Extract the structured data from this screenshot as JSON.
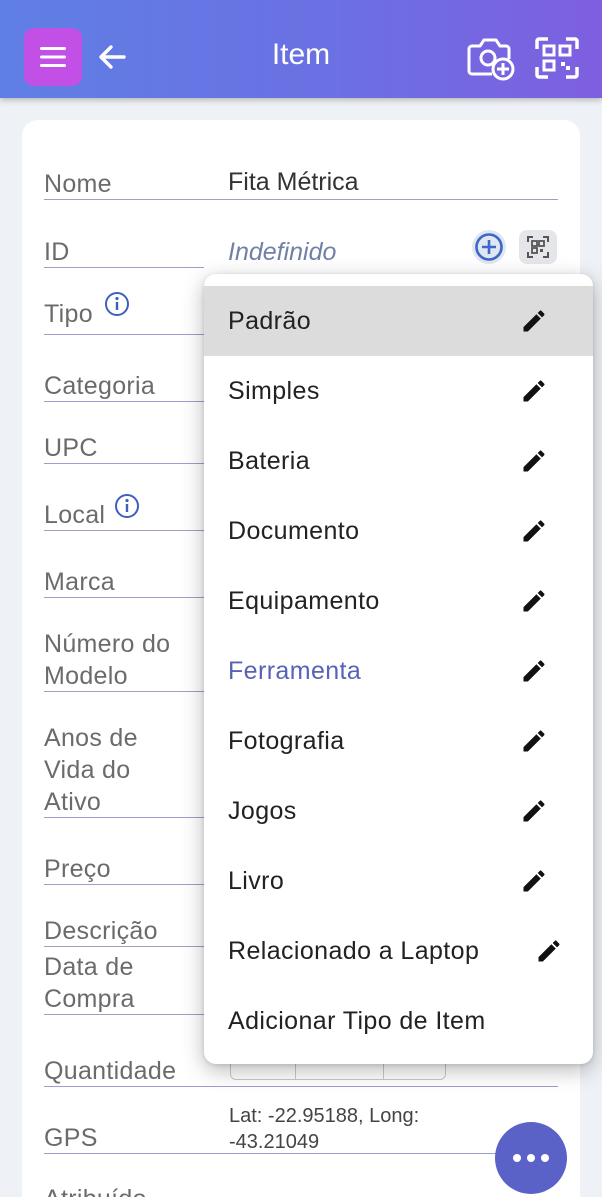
{
  "header": {
    "title": "Item",
    "menu_icon": "menu-icon",
    "back_icon": "arrow-left-icon",
    "camera_icon": "camera-add-icon",
    "scan_icon": "qr-scan-icon",
    "gradient": [
      "#5f7fe6",
      "#7e5fe0"
    ],
    "menu_color": "#c24fe6"
  },
  "form": {
    "name": {
      "label": "Nome",
      "value": "Fita Métrica"
    },
    "id": {
      "label": "ID",
      "placeholder": "Indefinido"
    },
    "type": {
      "label": "Tipo"
    },
    "category": {
      "label": "Categoria"
    },
    "upc": {
      "label": "UPC"
    },
    "location": {
      "label": "Local"
    },
    "brand": {
      "label": "Marca"
    },
    "model": {
      "label_1": "Número do",
      "label_2": "Modelo"
    },
    "life": {
      "label_1": "Anos de",
      "label_2": "Vida do",
      "label_3": "Ativo"
    },
    "price": {
      "label": "Preço"
    },
    "description": {
      "label": "Descrição"
    },
    "purchase": {
      "label_1": "Data de",
      "label_2": "Compra"
    },
    "quantity": {
      "label": "Quantidade"
    },
    "gps": {
      "label": "GPS",
      "line_1": "Lat: -22.95188, Long:",
      "line_2": "-43.21049"
    },
    "attributed": {
      "label": "Atribuído"
    }
  },
  "dropdown": {
    "items": [
      {
        "label": "Padrão",
        "selected": true
      },
      {
        "label": "Simples"
      },
      {
        "label": "Bateria"
      },
      {
        "label": "Documento"
      },
      {
        "label": "Equipamento"
      },
      {
        "label": "Ferramenta",
        "active": true
      },
      {
        "label": "Fotografia"
      },
      {
        "label": "Jogos"
      },
      {
        "label": "Livro"
      },
      {
        "label": "Relacionado a Laptop"
      },
      {
        "label": "Adicionar Tipo de Item"
      }
    ],
    "active_color": "#5862b6"
  },
  "fab": {
    "icon": "more-horizontal-icon",
    "color": "#5a62c8"
  }
}
